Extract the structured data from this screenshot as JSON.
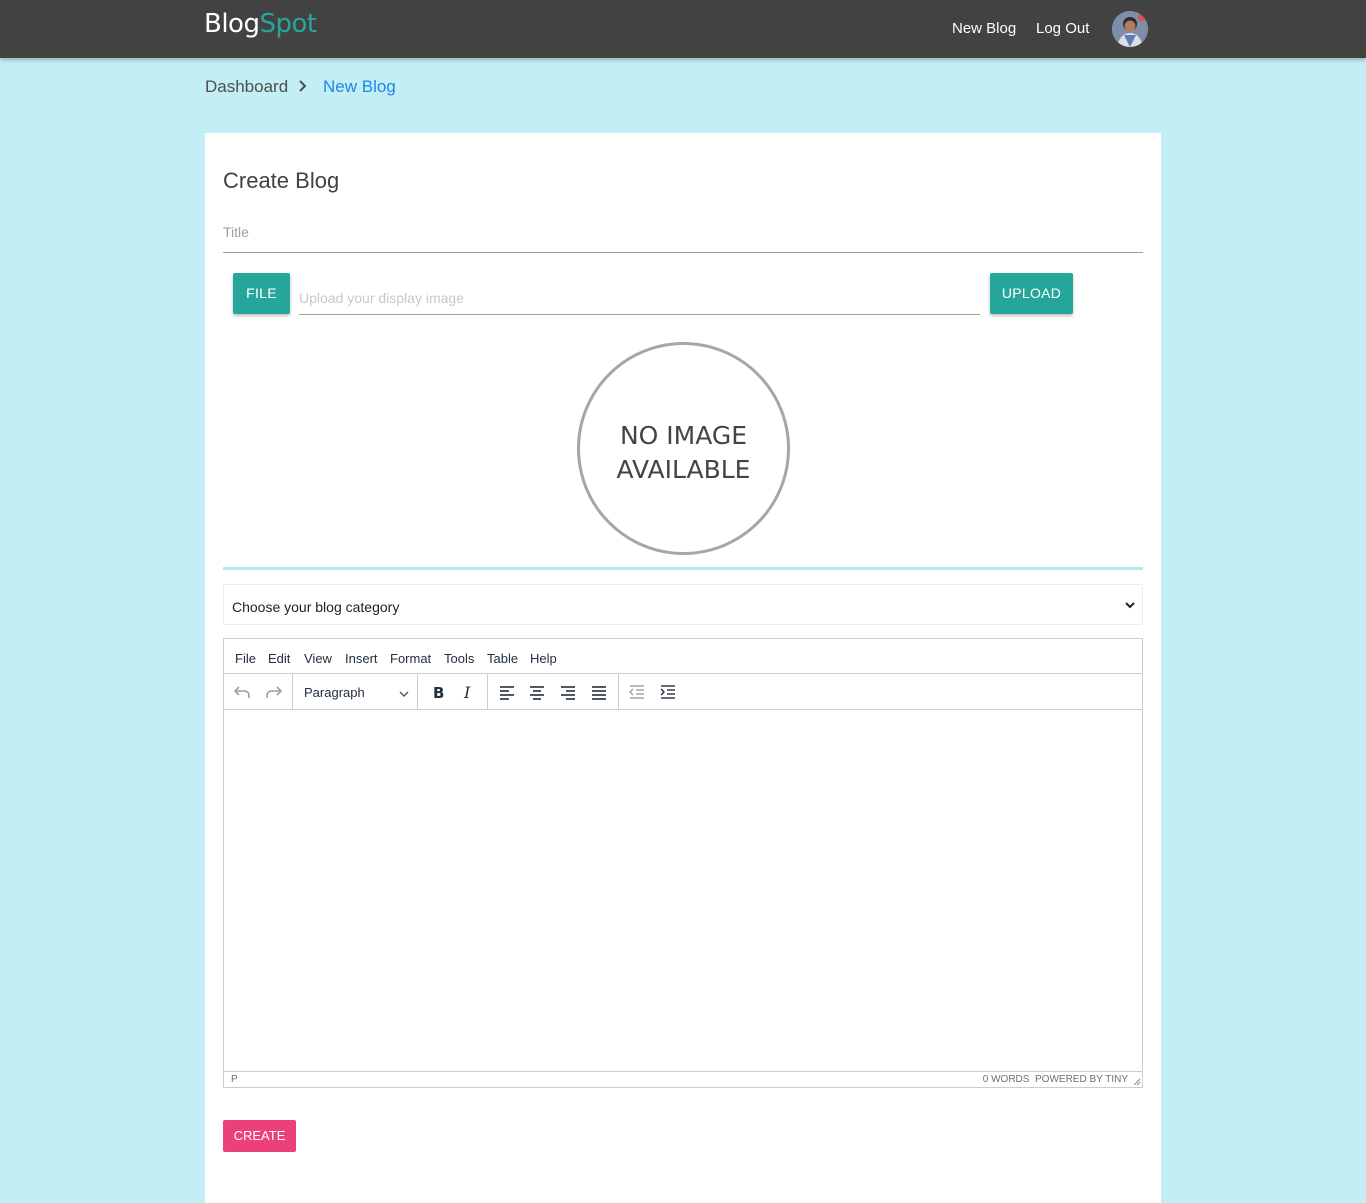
{
  "brand": {
    "part1": "Blog",
    "part2": "Spot",
    "accent": "#26a69a"
  },
  "nav": {
    "new_blog": "New Blog",
    "log_out": "Log Out"
  },
  "breadcrumb": {
    "items": [
      "Dashboard",
      "New Blog"
    ]
  },
  "form": {
    "heading": "Create Blog",
    "title_label": "Title",
    "file_button": "FILE",
    "upload_placeholder": "Upload your display image",
    "upload_button": "UPLOAD",
    "no_image": [
      "NO IMAGE",
      "AVAILABLE"
    ],
    "category_placeholder": "Choose your blog category",
    "create_button": "CREATE"
  },
  "editor": {
    "menu": [
      "File",
      "Edit",
      "View",
      "Insert",
      "Format",
      "Tools",
      "Table",
      "Help"
    ],
    "block_format": "Paragraph",
    "toolbar_icons": [
      "undo-icon",
      "redo-icon",
      "bold-icon",
      "italic-icon",
      "align-left-icon",
      "align-center-icon",
      "align-right-icon",
      "align-justify-icon",
      "outdent-icon",
      "indent-icon"
    ],
    "status_path": "P",
    "word_count": "0 WORDS",
    "powered_by": "POWERED BY TINY"
  },
  "colors": {
    "navbar": "#424242",
    "background": "#c3eef5",
    "teal_button": "#26a69a",
    "create_button": "#ec407a",
    "breadcrumb_active": "#1e88e5"
  }
}
